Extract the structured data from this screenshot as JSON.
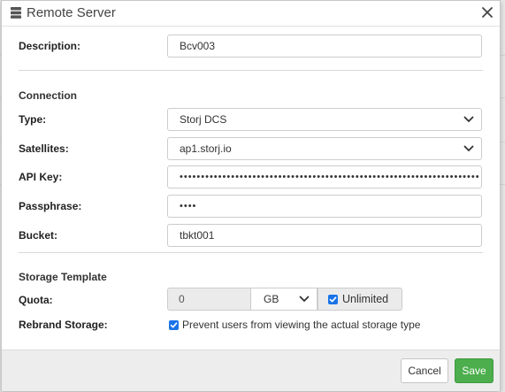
{
  "window": {
    "title": "Remote Server"
  },
  "fields": {
    "description": {
      "label": "Description:",
      "value": "Bcv003"
    },
    "type": {
      "label": "Type:",
      "value": "Storj DCS"
    },
    "satellites": {
      "label": "Satellites:",
      "value": "ap1.storj.io"
    },
    "api_key": {
      "label": "API Key:",
      "value": "••••••••••••••••••••••••••••••••••••••••••••••••••••••••••••••••••••••"
    },
    "passphrase": {
      "label": "Passphrase:",
      "value": "••••"
    },
    "bucket": {
      "label": "Bucket:",
      "value": "tbkt001"
    }
  },
  "sections": {
    "connection": "Connection",
    "storage_template": "Storage Template"
  },
  "quota": {
    "label": "Quota:",
    "value": "0",
    "unit": "GB",
    "unlimited_label": "Unlimited",
    "unlimited_checked": true
  },
  "rebrand": {
    "label": "Rebrand Storage:",
    "checkbox_label": "Prevent users from viewing the actual storage type",
    "checked": true
  },
  "buttons": {
    "cancel": "Cancel",
    "save": "Save"
  },
  "colors": {
    "save_button": "#4cae4c",
    "checkbox": "#1a73e8"
  }
}
